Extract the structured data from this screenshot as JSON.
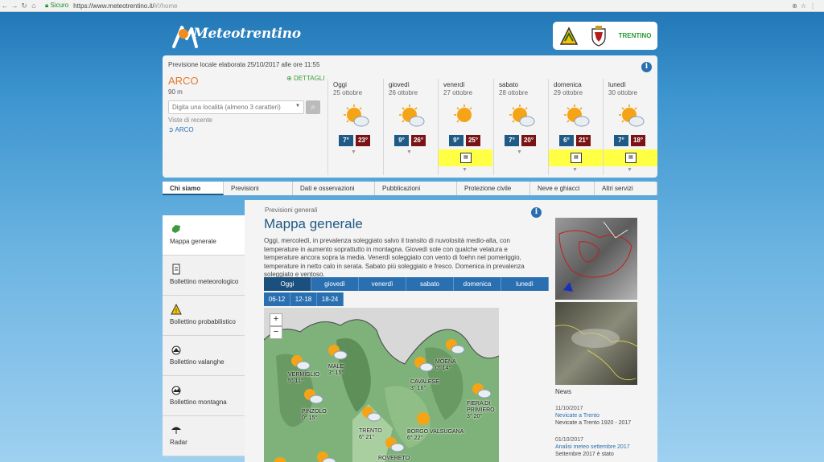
{
  "browser": {
    "secure_label": "Sicuro",
    "url_host": "https://www.meteotrentino.it/",
    "url_path": "#!/home"
  },
  "header": {
    "logo_text": "Meteotrentino",
    "partner_text": "TRENTINO"
  },
  "forecast": {
    "elaboration": "Previsione locale elaborata 25/10/2017 alle ore 11:55",
    "location": "ARCO",
    "altitude": "90 m",
    "details_label": "DETTAGLI",
    "search_placeholder": "Digita una località (almeno 3 caratteri)",
    "recent_label": "Viste di recente",
    "recent_item": "ARCO",
    "days": [
      {
        "name": "Oggi",
        "date": "25 ottobre",
        "icon": "sun-cloud-icon",
        "min": "7°",
        "max": "23°",
        "warning": false
      },
      {
        "name": "giovedì",
        "date": "26 ottobre",
        "icon": "sun-cloud-icon",
        "min": "9°",
        "max": "26°",
        "warning": false
      },
      {
        "name": "venerdì",
        "date": "27 ottobre",
        "icon": "sun-icon",
        "min": "9°",
        "max": "25°",
        "warning": true
      },
      {
        "name": "sabato",
        "date": "28 ottobre",
        "icon": "sun-cloud-icon",
        "min": "7°",
        "max": "20°",
        "warning": false
      },
      {
        "name": "domenica",
        "date": "29 ottobre",
        "icon": "sun-cloud-icon",
        "min": "6°",
        "max": "21°",
        "warning": true
      },
      {
        "name": "lunedì",
        "date": "30 ottobre",
        "icon": "sun-cloud-icon",
        "min": "7°",
        "max": "18°",
        "warning": true
      }
    ]
  },
  "nav": {
    "items": [
      "Chi siamo",
      "Previsioni",
      "Dati e osservazioni",
      "Pubblicazioni",
      "Protezione civile",
      "Neve e ghiacci",
      "Altri servizi"
    ]
  },
  "sidebar": {
    "items": [
      {
        "label": "Mappa generale",
        "icon": "map-icon"
      },
      {
        "label": "Bollettino meteorologico",
        "icon": "document-icon"
      },
      {
        "label": "Bollettino probabilistico",
        "icon": "warning-icon"
      },
      {
        "label": "Bollettino valanghe",
        "icon": "avalanche-icon"
      },
      {
        "label": "Bollettino montagna",
        "icon": "mountain-icon"
      },
      {
        "label": "Radar",
        "icon": "umbrella-icon"
      }
    ]
  },
  "content": {
    "breadcrumb": "Previsioni generali",
    "title": "Mappa generale",
    "description": "Oggi, mercoledì, in prevalenza soleggiato salvo il transito di nuvolosità medio-alta, con temperature in aumento soprattutto in montagna. Giovedì sole con qualche velatura e temperature ancora sopra la media. Venerdì soleggiato con vento di foehn nel pomeriggio, temperature in netto calo in serata. Sabato più soleggiato e fresco. Domenica in prevalenza soleggiato e ventoso.",
    "day_tabs": [
      "Oggi",
      "giovedì",
      "venerdì",
      "sabato",
      "domenica",
      "lunedì"
    ],
    "time_tabs": [
      "06-12",
      "12-18",
      "18-24"
    ],
    "zoom_in": "+",
    "zoom_out": "−"
  },
  "map": {
    "places": [
      {
        "name": "VERMIGLIO",
        "temps": "5°  11°"
      },
      {
        "name": "MALE'",
        "temps": "3°  15°"
      },
      {
        "name": "MOENA",
        "temps": "0°  14°"
      },
      {
        "name": "CAVALESE",
        "temps": "3°  16°"
      },
      {
        "name": "FIERA DI PRIMIERO",
        "temps": "3°  20°"
      },
      {
        "name": "PINZOLO",
        "temps": "0°  15°"
      },
      {
        "name": "TRENTO",
        "temps": "6°  21°"
      },
      {
        "name": "BORGO VALSUGANA",
        "temps": "6°  22°"
      },
      {
        "name": "ROVERETO",
        "temps": ""
      }
    ]
  },
  "news": {
    "heading": "News",
    "items": [
      {
        "date": "11/10/2017",
        "link": "Nevicate a Trento",
        "text": "Nevicate a Trento 1920 - 2017"
      },
      {
        "date": "01/10/2017",
        "link": "Analisi meteo settembre 2017",
        "text": "Settembre 2017 è stato"
      }
    ]
  }
}
